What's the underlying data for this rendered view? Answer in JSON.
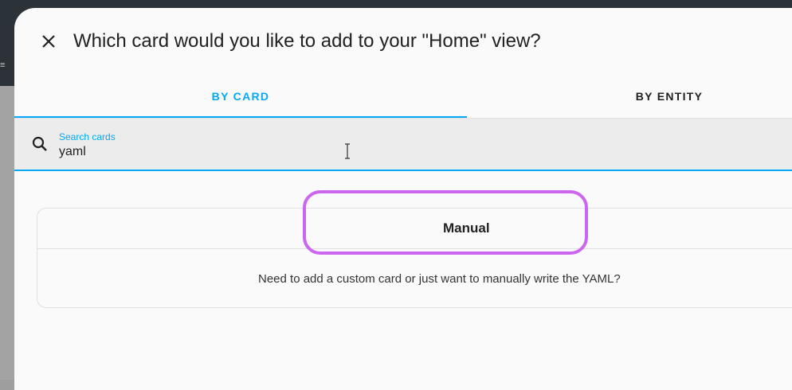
{
  "dialog": {
    "title": "Which card would you like to add to your \"Home\" view?",
    "close_icon": "close-icon"
  },
  "tabs": [
    {
      "label": "BY CARD",
      "selected": true
    },
    {
      "label": "BY ENTITY",
      "selected": false
    }
  ],
  "search": {
    "label": "Search cards",
    "value": "yaml",
    "icon": "search-icon"
  },
  "card": {
    "title": "Manual",
    "description": "Need to add a custom card or just want to manually write the YAML?"
  },
  "colors": {
    "accent": "#03a9f4",
    "highlight": "#cc66ee",
    "topbar": "#2b3238",
    "dialog_bg": "#fafafa"
  }
}
